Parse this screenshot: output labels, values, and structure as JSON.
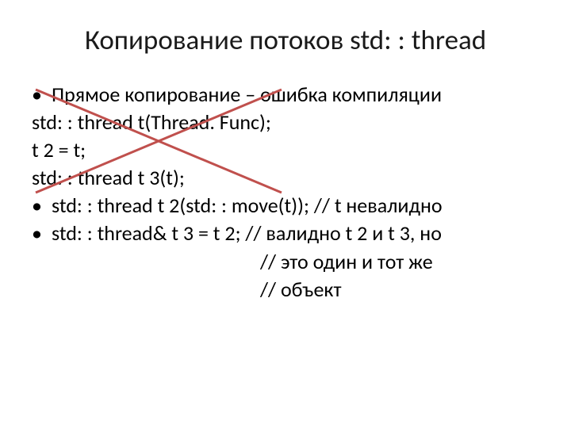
{
  "slide": {
    "title": "Копирование потоков std: : thread",
    "bullets": {
      "b1": "Прямое копирование – ошибка компиляции",
      "code1": "std: : thread t(Thread. Func);",
      "code2": "t 2 = t;",
      "code3": "std: : thread t 3(t);",
      "b2": "std: : thread t 2(std: : move(t)); // t невалидно",
      "b3": "std: : thread& t 3 = t 2; // валидно t 2 и t 3, но",
      "comment1": "// это один и тот же",
      "comment2": "// объект"
    },
    "bullet_char": "•"
  }
}
